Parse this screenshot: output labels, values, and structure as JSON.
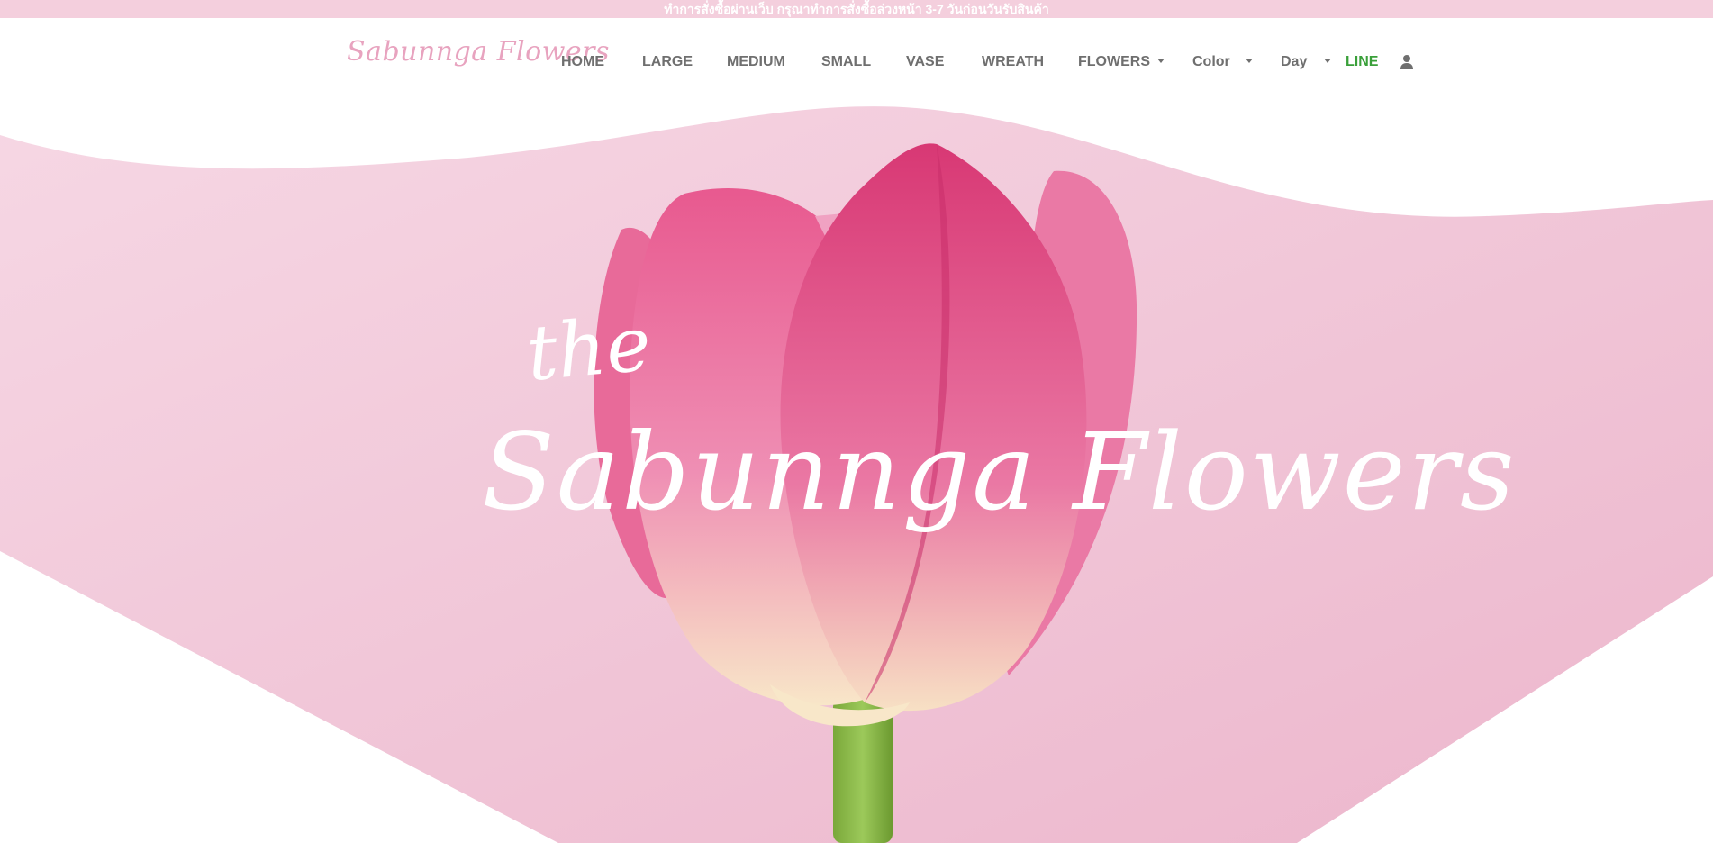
{
  "announcement": "ทำการสั่งซื้อผ่านเว็บ กรุณาทำการสั่งซื้อล่วงหน้า 3-7 วันก่อนวันรับสินค้า",
  "logo": "Sabunnga Flowers",
  "nav": {
    "items": [
      {
        "label": "HOME"
      },
      {
        "label": "LARGE"
      },
      {
        "label": "MEDIUM"
      },
      {
        "label": "SMALL"
      },
      {
        "label": "VASE"
      },
      {
        "label": "WREATH"
      },
      {
        "label": "FLOWERS"
      },
      {
        "label": "Color"
      },
      {
        "label": "Day"
      },
      {
        "label": "LINE"
      }
    ],
    "user_icon": "user-icon",
    "caret_icon": "caret-down-icon"
  },
  "hero": {
    "title_small": "the",
    "title": "Sabunnga Flowers"
  },
  "colors": {
    "announcement_bg": "#f4cfdd",
    "hero_bg": "#f2cadb",
    "line_green": "#3aa03a",
    "nav_text": "#6f6f6f",
    "tulip_pink": "#e24d85"
  }
}
